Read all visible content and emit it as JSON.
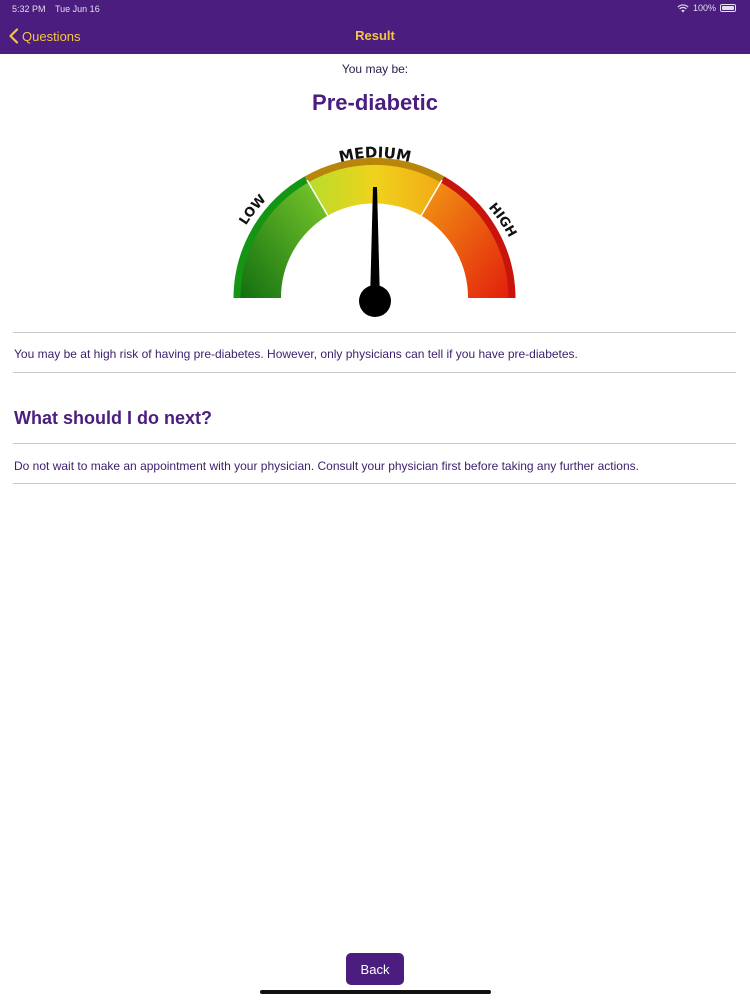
{
  "status": {
    "time": "5:32 PM",
    "date": "Tue Jun 16",
    "battery": "100%"
  },
  "nav": {
    "back_label": "Questions",
    "title": "Result"
  },
  "result": {
    "intro": "You may be:",
    "title": "Pre-diabetic"
  },
  "gauge": {
    "labels": {
      "low": "LOW",
      "medium": "MEDIUM",
      "high": "HIGH"
    },
    "level": 0.5,
    "colors": {
      "low": "#1e9a1e",
      "medium": "#e8b81c",
      "high": "#d11a0e",
      "rim": "#b8860b",
      "needle": "#000000"
    }
  },
  "body": {
    "risk_text": "You may be at high risk of having pre-diabetes. However, only physicians can tell if you have pre-diabetes.",
    "next_heading": "What should I do next?",
    "advice_text": "Do not wait to make an appointment with your physician. Consult your physician first before taking any further actions."
  },
  "footer": {
    "back_button": "Back"
  },
  "theme": {
    "primary": "#4a1d7e",
    "accent": "#f5c542"
  }
}
